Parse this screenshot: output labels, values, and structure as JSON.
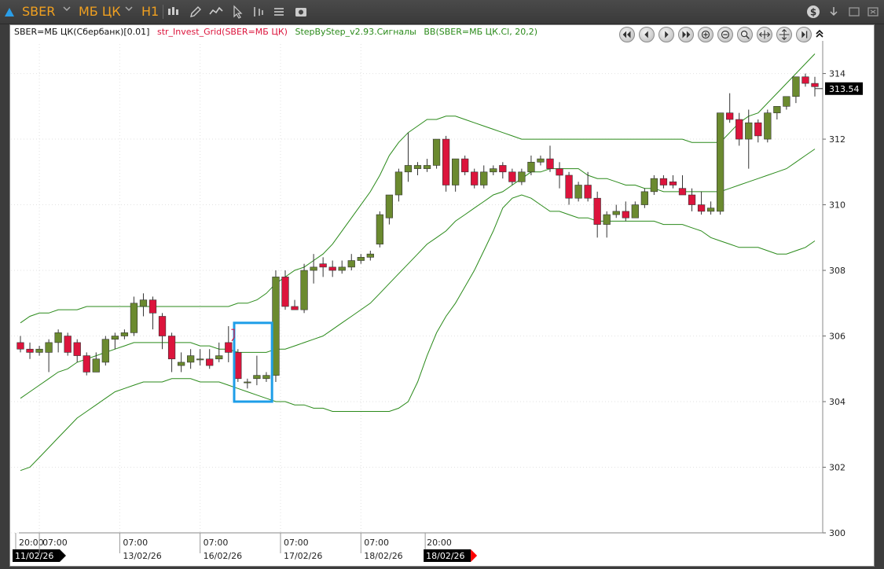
{
  "toolbar": {
    "symbol": "SBER",
    "board": "МБ ЦК",
    "timeframe": "H1"
  },
  "legend": {
    "instrument": "SBER=МБ ЦК(Сбербанк)[0.01]",
    "indicator_grid": "str_Invest_Grid(SBER=МБ ЦК)",
    "indicator_signals": "StepByStep_v2.93.Сигналы",
    "indicator_bb": "BB(SBER=МБ ЦК.Cl, 20,2)"
  },
  "colors": {
    "up": "#6b8a2f",
    "down": "#dc143c",
    "band": "#2a8a1a",
    "highlight": "#1e9ee8",
    "accent": "#f0a020"
  },
  "chart_data": {
    "type": "candlestick",
    "ylim": [
      300,
      314.9
    ],
    "yticks": [
      300,
      302,
      304,
      306,
      308,
      310,
      312,
      314
    ],
    "last_price_label": "313.54",
    "x_labels": [
      {
        "time": "20:00",
        "date": "11/02/26",
        "index": -0.5
      },
      {
        "time": "07:00",
        "date": "",
        "index": 2
      },
      {
        "time": "07:00",
        "date": "13/02/26",
        "index": 10.5
      },
      {
        "time": "07:00",
        "date": "16/02/26",
        "index": 19
      },
      {
        "time": "07:00",
        "date": "17/02/26",
        "index": 27.5
      },
      {
        "time": "07:00",
        "date": "18/02/26",
        "index": 36
      },
      {
        "time": "20:00",
        "date": "18/02/26",
        "index": 42.8
      }
    ],
    "candles": [
      [
        305.8,
        306.0,
        305.5,
        305.6
      ],
      [
        305.6,
        305.8,
        305.3,
        305.5
      ],
      [
        305.5,
        305.7,
        305.4,
        305.6
      ],
      [
        305.5,
        305.9,
        304.9,
        305.8
      ],
      [
        305.8,
        306.2,
        305.5,
        306.1
      ],
      [
        306.0,
        306.1,
        305.4,
        305.5
      ],
      [
        305.8,
        305.9,
        305.2,
        305.4
      ],
      [
        305.4,
        305.5,
        304.8,
        304.9
      ],
      [
        304.9,
        305.5,
        304.9,
        305.3
      ],
      [
        305.2,
        306.0,
        305.1,
        305.9
      ],
      [
        305.9,
        306.1,
        305.6,
        306.0
      ],
      [
        306.0,
        306.2,
        305.9,
        306.1
      ],
      [
        306.1,
        307.2,
        306.0,
        307.0
      ],
      [
        306.9,
        307.3,
        306.6,
        307.1
      ],
      [
        307.1,
        307.2,
        306.2,
        306.7
      ],
      [
        306.6,
        306.7,
        305.6,
        306.0
      ],
      [
        306.0,
        306.1,
        304.9,
        305.3
      ],
      [
        305.1,
        305.5,
        304.9,
        305.2
      ],
      [
        305.2,
        305.6,
        305.0,
        305.4
      ],
      [
        305.3,
        305.6,
        305.1,
        305.3
      ],
      [
        305.3,
        305.6,
        305.0,
        305.1
      ],
      [
        305.3,
        305.8,
        305.2,
        305.4
      ],
      [
        305.8,
        306.3,
        305.2,
        305.5
      ],
      [
        305.5,
        305.6,
        304.6,
        304.7
      ],
      [
        304.6,
        304.7,
        304.4,
        304.6
      ],
      [
        304.7,
        305.4,
        304.5,
        304.8
      ],
      [
        304.7,
        304.9,
        304.6,
        304.8
      ],
      [
        304.8,
        308.0,
        304.6,
        307.8
      ],
      [
        307.8,
        308.0,
        306.8,
        306.9
      ],
      [
        306.9,
        307.1,
        306.8,
        306.8
      ],
      [
        306.8,
        308.2,
        306.7,
        308.0
      ],
      [
        308.0,
        308.5,
        307.6,
        308.1
      ],
      [
        308.2,
        308.4,
        307.8,
        308.1
      ],
      [
        308.1,
        308.3,
        307.8,
        308.0
      ],
      [
        308.0,
        308.3,
        307.9,
        308.1
      ],
      [
        308.1,
        308.5,
        308.0,
        308.3
      ],
      [
        308.3,
        308.5,
        308.2,
        308.4
      ],
      [
        308.4,
        308.6,
        308.3,
        308.5
      ],
      [
        308.8,
        309.8,
        308.7,
        309.7
      ],
      [
        309.6,
        310.3,
        309.4,
        310.3
      ],
      [
        310.3,
        311.1,
        310.1,
        311.0
      ],
      [
        311.0,
        312.2,
        310.7,
        311.2
      ],
      [
        311.1,
        311.3,
        310.9,
        311.2
      ],
      [
        311.1,
        311.4,
        311.0,
        311.2
      ],
      [
        311.2,
        312.0,
        311.1,
        312.0
      ],
      [
        312.0,
        312.1,
        310.4,
        310.6
      ],
      [
        310.6,
        311.4,
        310.4,
        311.4
      ],
      [
        311.4,
        311.5,
        310.9,
        311.0
      ],
      [
        311.0,
        311.1,
        310.5,
        310.6
      ],
      [
        310.6,
        311.2,
        310.5,
        311.0
      ],
      [
        311.0,
        311.2,
        310.9,
        311.1
      ],
      [
        311.2,
        311.3,
        310.8,
        311.0
      ],
      [
        311.0,
        311.1,
        310.6,
        310.7
      ],
      [
        310.7,
        311.1,
        310.6,
        311.0
      ],
      [
        311.0,
        311.5,
        310.9,
        311.3
      ],
      [
        311.3,
        311.5,
        311.2,
        311.4
      ],
      [
        311.4,
        311.8,
        311.0,
        311.1
      ],
      [
        311.1,
        311.3,
        310.5,
        310.9
      ],
      [
        310.9,
        311.0,
        310.0,
        310.2
      ],
      [
        310.2,
        310.7,
        310.1,
        310.6
      ],
      [
        310.6,
        311.0,
        310.1,
        310.2
      ],
      [
        310.2,
        310.4,
        309.0,
        309.4
      ],
      [
        309.4,
        309.8,
        309.0,
        309.7
      ],
      [
        309.7,
        310.0,
        309.6,
        309.8
      ],
      [
        309.8,
        310.1,
        309.5,
        309.6
      ],
      [
        309.6,
        310.1,
        309.6,
        310.0
      ],
      [
        310.0,
        310.5,
        309.9,
        310.4
      ],
      [
        310.4,
        310.9,
        310.3,
        310.8
      ],
      [
        310.8,
        310.9,
        310.5,
        310.6
      ],
      [
        310.7,
        310.9,
        310.5,
        310.6
      ],
      [
        310.5,
        310.9,
        310.3,
        310.3
      ],
      [
        310.3,
        310.5,
        309.8,
        310.0
      ],
      [
        310.0,
        310.4,
        309.7,
        309.8
      ],
      [
        309.8,
        310.1,
        309.7,
        309.9
      ],
      [
        309.8,
        312.8,
        309.7,
        312.8
      ],
      [
        312.8,
        313.4,
        312.5,
        312.6
      ],
      [
        312.6,
        312.8,
        311.8,
        312.0
      ],
      [
        312.0,
        312.9,
        311.1,
        312.5
      ],
      [
        312.5,
        312.6,
        311.9,
        312.1
      ],
      [
        312.0,
        312.9,
        311.9,
        312.8
      ],
      [
        312.8,
        313.0,
        312.6,
        313.0
      ],
      [
        313.0,
        313.3,
        312.9,
        313.3
      ],
      [
        313.3,
        313.9,
        313.1,
        313.9
      ],
      [
        313.9,
        314.0,
        313.6,
        313.7
      ],
      [
        313.7,
        313.9,
        313.3,
        313.6
      ]
    ],
    "bb_upper": [
      306.4,
      306.6,
      306.7,
      306.7,
      306.8,
      306.8,
      306.8,
      306.9,
      306.9,
      306.9,
      306.9,
      306.9,
      306.9,
      306.9,
      306.9,
      306.9,
      306.9,
      306.9,
      306.9,
      306.9,
      306.9,
      306.9,
      306.9,
      307.0,
      307.0,
      307.1,
      307.3,
      307.6,
      307.8,
      308.0,
      308.1,
      308.3,
      308.5,
      308.8,
      309.2,
      309.6,
      310.0,
      310.4,
      310.9,
      311.5,
      311.9,
      312.2,
      312.4,
      312.6,
      312.6,
      312.7,
      312.7,
      312.6,
      312.5,
      312.4,
      312.3,
      312.2,
      312.1,
      312.0,
      312.0,
      312.0,
      312.0,
      312.0,
      312.0,
      312.0,
      312.0,
      312.0,
      312.0,
      312.0,
      312.0,
      312.0,
      312.0,
      312.0,
      312.0,
      312.0,
      312.0,
      311.9,
      311.9,
      311.9,
      311.9,
      312.2,
      312.5,
      312.7,
      312.8,
      313.1,
      313.4,
      313.7,
      314.0,
      314.3,
      314.6
    ],
    "bb_middle": [
      304.1,
      304.3,
      304.5,
      304.7,
      304.9,
      305.0,
      305.2,
      305.3,
      305.4,
      305.5,
      305.6,
      305.7,
      305.8,
      305.8,
      305.8,
      305.8,
      305.8,
      305.8,
      305.8,
      305.7,
      305.7,
      305.6,
      305.6,
      305.5,
      305.5,
      305.5,
      305.5,
      305.6,
      305.6,
      305.7,
      305.8,
      305.9,
      306.0,
      306.2,
      306.4,
      306.6,
      306.8,
      307.0,
      307.3,
      307.6,
      307.9,
      308.2,
      308.5,
      308.8,
      309.0,
      309.2,
      309.5,
      309.7,
      309.9,
      310.1,
      310.3,
      310.4,
      310.6,
      310.8,
      311.0,
      311.0,
      311.1,
      311.1,
      311.1,
      311.1,
      310.9,
      310.8,
      310.8,
      310.7,
      310.6,
      310.6,
      310.5,
      310.5,
      310.4,
      310.4,
      310.4,
      310.4,
      310.4,
      310.4,
      310.4,
      310.5,
      310.6,
      310.7,
      310.8,
      310.9,
      311.0,
      311.1,
      311.3,
      311.5,
      311.7
    ],
    "bb_lower": [
      301.9,
      302.0,
      302.3,
      302.6,
      302.9,
      303.2,
      303.5,
      303.7,
      303.9,
      304.1,
      304.3,
      304.4,
      304.5,
      304.6,
      304.6,
      304.6,
      304.7,
      304.7,
      304.7,
      304.6,
      304.6,
      304.6,
      304.5,
      304.4,
      304.3,
      304.2,
      304.1,
      304.0,
      304.0,
      303.9,
      303.9,
      303.8,
      303.8,
      303.7,
      303.7,
      303.7,
      303.7,
      303.7,
      303.7,
      303.7,
      303.8,
      304.0,
      304.6,
      305.4,
      306.1,
      306.6,
      307.0,
      307.5,
      308.0,
      308.6,
      309.2,
      309.9,
      310.2,
      310.3,
      310.2,
      310.0,
      309.8,
      309.8,
      309.7,
      309.6,
      309.6,
      309.5,
      309.5,
      309.5,
      309.5,
      309.5,
      309.5,
      309.5,
      309.4,
      309.4,
      309.4,
      309.3,
      309.2,
      309.0,
      308.9,
      308.8,
      308.7,
      308.7,
      308.7,
      308.6,
      308.5,
      308.5,
      308.6,
      308.7,
      308.9
    ],
    "highlight": {
      "from": 22.6,
      "to": 26.6,
      "low": 304.0,
      "high": 306.4
    }
  }
}
